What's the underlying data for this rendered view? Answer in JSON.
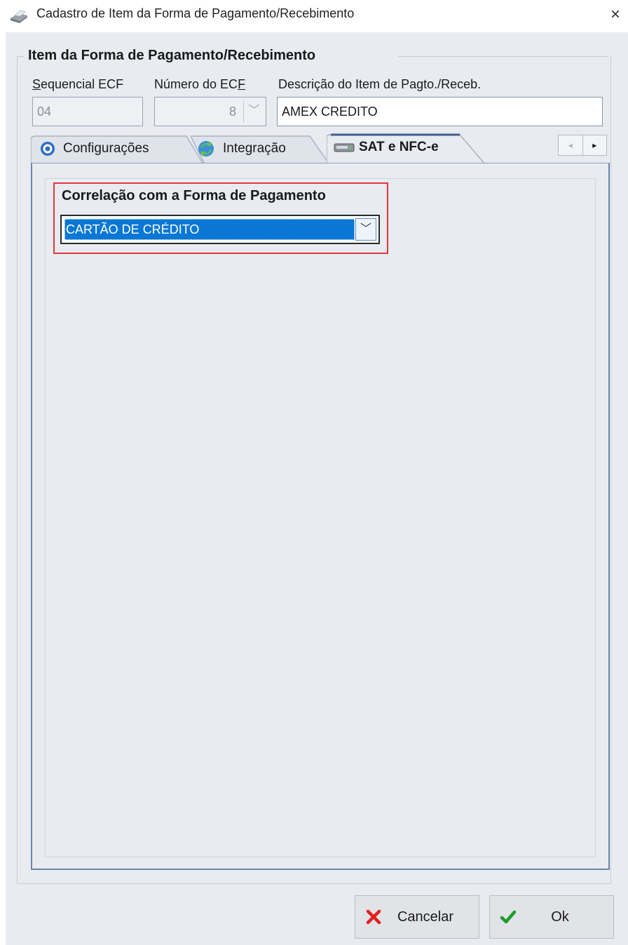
{
  "window": {
    "title": "Cadastro de Item da Forma de Pagamento/Recebimento",
    "icon": "printer-icon",
    "close_label": "×"
  },
  "group": {
    "title": "Item da Forma de Pagamento/Recebimento"
  },
  "fields": {
    "sequencial": {
      "label_first": "S",
      "label_rest": "equencial ECF",
      "value": "04",
      "enabled": false
    },
    "numero": {
      "label_start": "Número do EC",
      "label_accel": "F",
      "value": "8",
      "enabled": false
    },
    "descricao": {
      "label": "Descrição do Item de Pagto./Receb.",
      "value": "AMEX CREDITO"
    }
  },
  "tabs": [
    {
      "label": "Configurações",
      "icon": "gear-icon",
      "active": false
    },
    {
      "label": "Integração",
      "icon": "refresh-icon",
      "active": false
    },
    {
      "label": "SAT e NFC-e",
      "icon": "drive-icon",
      "active": true
    }
  ],
  "tab_scroll": {
    "left": "◂",
    "right": "▸"
  },
  "sat": {
    "correlacao_label": "Correlação com a Forma de Pagamento",
    "correlacao_value": "CARTÃO DE CRÉDITO"
  },
  "buttons": {
    "cancel_label": "Cancelar",
    "ok_label": "Ok"
  },
  "colors": {
    "accent": "#0a77d4",
    "highlight_border": "#e0383e",
    "cancel_icon": "#e02020",
    "ok_icon": "#1e9a2e"
  }
}
